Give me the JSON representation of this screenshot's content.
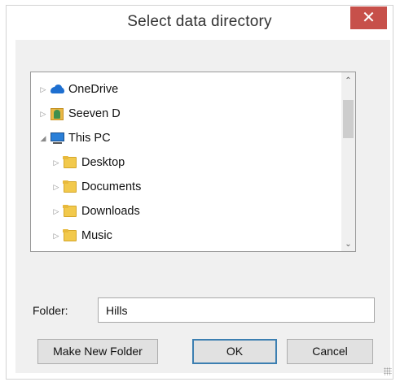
{
  "window": {
    "title": "Select data directory",
    "close_glyph": "✕"
  },
  "tree": {
    "items": [
      {
        "label": "OneDrive",
        "icon": "onedrive-icon",
        "expander": "▷",
        "depth": 1
      },
      {
        "label": "Seeven D",
        "icon": "user-folder-icon",
        "expander": "▷",
        "depth": 1
      },
      {
        "label": "This PC",
        "icon": "computer-icon",
        "expander": "◢",
        "depth": 1
      },
      {
        "label": "Desktop",
        "icon": "desktop-folder-icon",
        "expander": "▷",
        "depth": 2
      },
      {
        "label": "Documents",
        "icon": "documents-folder-icon",
        "expander": "▷",
        "depth": 2
      },
      {
        "label": "Downloads",
        "icon": "downloads-folder-icon",
        "expander": "▷",
        "depth": 2
      },
      {
        "label": "Music",
        "icon": "music-folder-icon",
        "expander": "▷",
        "depth": 2
      }
    ],
    "scroll_up": "⌃",
    "scroll_down": "⌄"
  },
  "folder": {
    "label": "Folder:",
    "value": "Hills"
  },
  "buttons": {
    "make_new_folder": "Make New Folder",
    "ok": "OK",
    "cancel": "Cancel"
  },
  "colors": {
    "close_button": "#c7504a",
    "onedrive_blue": "#1e6fd0",
    "folder_yellow": "#f2c94c"
  }
}
